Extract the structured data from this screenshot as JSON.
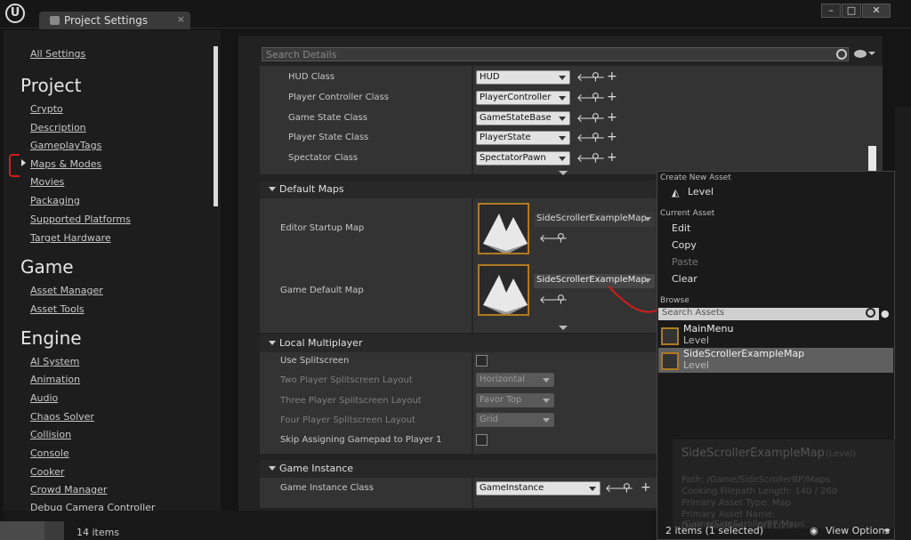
{
  "window": {
    "tab_title": "Project Settings",
    "logo": "U",
    "min": "–",
    "max": "□",
    "close": "✕"
  },
  "sidebar": {
    "all_settings": "All Settings",
    "project_head": "Project",
    "project_items": [
      "Crypto",
      "Description",
      "GameplayTags",
      "Maps & Modes",
      "Movies",
      "Packaging",
      "Supported Platforms",
      "Target Hardware"
    ],
    "game_head": "Game",
    "game_items": [
      "Asset Manager",
      "Asset Tools"
    ],
    "engine_head": "Engine",
    "engine_items": [
      "AI System",
      "Animation",
      "Audio",
      "Chaos Solver",
      "Collision",
      "Console",
      "Cooker",
      "Crowd Manager",
      "Debug Camera Controller"
    ]
  },
  "status": {
    "items": "14 items"
  },
  "details": {
    "search_placeholder": "Search Details",
    "class_rows": [
      {
        "label": "HUD Class",
        "value": "HUD"
      },
      {
        "label": "Player Controller Class",
        "value": "PlayerController"
      },
      {
        "label": "Game State Class",
        "value": "GameStateBase"
      },
      {
        "label": "Player State Class",
        "value": "PlayerState"
      },
      {
        "label": "Spectator Class",
        "value": "SpectatorPawn"
      }
    ],
    "default_maps": {
      "header": "Default Maps",
      "editor_label": "Editor Startup Map",
      "editor_value": "SideScrollerExampleMap",
      "game_label": "Game Default Map",
      "game_value": "SideScrollerExampleMap"
    },
    "local_mp": {
      "header": "Local Multiplayer",
      "rows": [
        {
          "label": "Use Splitscreen",
          "value": ""
        },
        {
          "label": "Two Player Splitscreen Layout",
          "value": "Horizontal"
        },
        {
          "label": "Three Player Splitscreen Layout",
          "value": "Favor Top"
        },
        {
          "label": "Four Player Splitscreen Layout",
          "value": "Grid"
        },
        {
          "label": "Skip Assigning Gamepad to Player 1",
          "value": ""
        }
      ]
    },
    "game_instance": {
      "header": "Game Instance",
      "label": "Game Instance Class",
      "value": "GameInstance"
    }
  },
  "dropdown": {
    "create_head": "Create New Asset",
    "create_item": "Level",
    "current_head": "Current Asset",
    "current_items": [
      "Edit",
      "Copy",
      "Paste",
      "Clear"
    ],
    "browse_head": "Browse",
    "search_placeholder": "Search Assets",
    "assets": [
      {
        "name": "MainMenu",
        "type": "Level"
      },
      {
        "name": "SideScrollerExampleMap",
        "type": "Level"
      }
    ],
    "footer_count": "2 items (1 selected)",
    "view_options": "View Options"
  },
  "tooltip": {
    "title": "SideScrollerExampleMap",
    "title_type": "(Level)",
    "lines": [
      "Path: /Game/SideScrollerBP/Maps",
      "Cooking Filepath Length: 140 / 260",
      "Primary Asset Type: Map",
      "Primary Asset Name: /Game/SideScrollerBP/Maps",
      "Date Modified: ...0/11/20"
    ]
  },
  "colors": {
    "annotation": "#d21c1c",
    "thumb_border": "#b07a22",
    "bg": "#151515"
  }
}
